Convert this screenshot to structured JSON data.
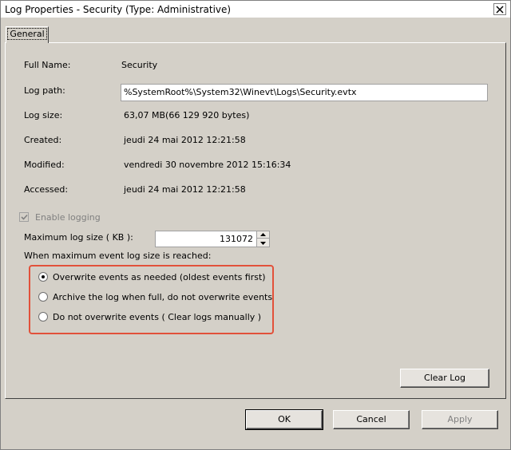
{
  "window": {
    "title": "Log Properties - Security (Type: Administrative)"
  },
  "tabs": [
    {
      "label": "General",
      "active": true
    }
  ],
  "general": {
    "full_name_label": "Full Name:",
    "full_name_value": "Security",
    "log_path_label": "Log path:",
    "log_path_value": "%SystemRoot%\\System32\\Winevt\\Logs\\Security.evtx",
    "log_size_label": "Log size:",
    "log_size_value": "63,07 MB(66 129 920 bytes)",
    "created_label": "Created:",
    "created_value": "jeudi 24 mai 2012 12:21:58",
    "modified_label": "Modified:",
    "modified_value": "vendredi 30 novembre 2012 15:16:34",
    "accessed_label": "Accessed:",
    "accessed_value": "jeudi 24 mai 2012 12:21:58",
    "enable_logging_label": "Enable logging",
    "enable_logging_checked": true,
    "max_size_label": "Maximum log size ( KB ):",
    "max_size_value": "131072",
    "policy_heading": "When maximum event log size is reached:",
    "policy_options": [
      {
        "label": "Overwrite events as needed (oldest events first)",
        "checked": true
      },
      {
        "label": "Archive the log when full, do not overwrite events",
        "checked": false
      },
      {
        "label": "Do not overwrite events ( Clear logs manually )",
        "checked": false
      }
    ],
    "clear_log_label": "Clear Log"
  },
  "footer": {
    "ok_label": "OK",
    "cancel_label": "Cancel",
    "apply_label": "Apply"
  },
  "colors": {
    "highlight_border": "#e2513a",
    "dialog_bg": "#d4d0c8"
  }
}
